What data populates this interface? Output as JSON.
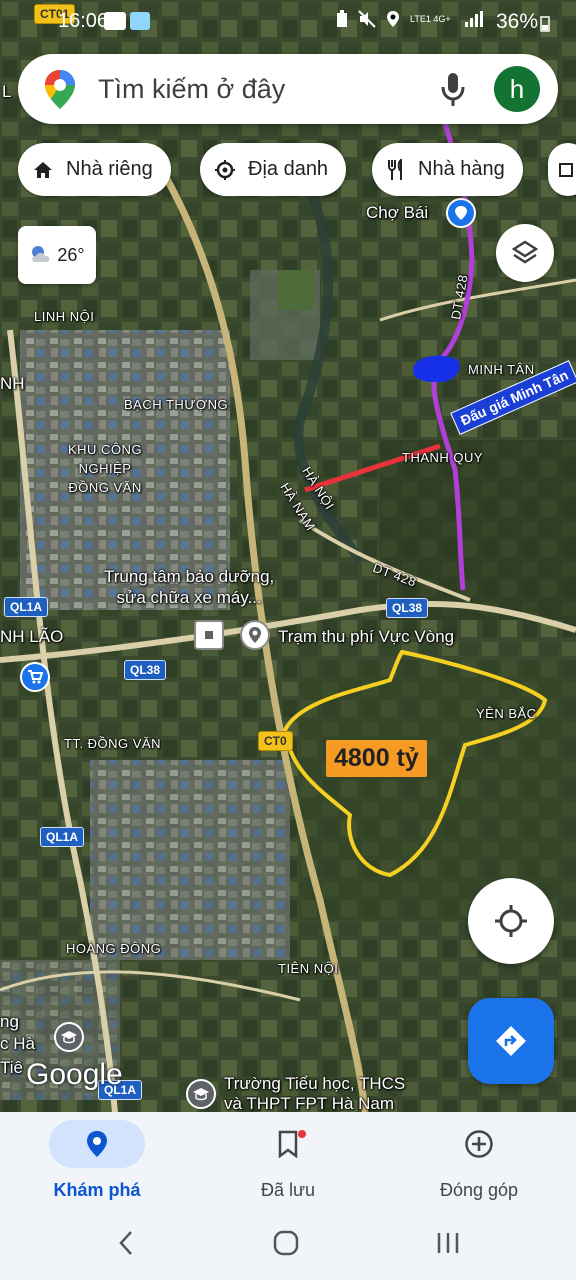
{
  "status_bar": {
    "time": "16:06",
    "network": "LTE1 4G+",
    "battery": "36%"
  },
  "search": {
    "placeholder": "Tìm kiếm ở đây",
    "avatar_letter": "h"
  },
  "chips": [
    {
      "label": "Nhà riêng",
      "icon": "home-icon"
    },
    {
      "label": "Địa danh",
      "icon": "landmark-icon"
    },
    {
      "label": "Nhà hàng",
      "icon": "restaurant-icon"
    }
  ],
  "weather": {
    "temp": "26°",
    "icon": "partly-cloudy-icon"
  },
  "map": {
    "places": {
      "cho_bai": "Chợ Bái",
      "linh_noi": "LINH NỘI",
      "bach_thuong": "BẠCH THƯỢNG",
      "kcn": "KHU CÔNG\nNGHIỆP\nĐỒNG VĂN",
      "minh_tan": "MINH TÂN",
      "thanh_quy": "THANH QUY",
      "ha_noi": "HÀ NỘI",
      "ha_nam": "HÀ NAM",
      "service_center": "Trung tâm bảo dưỡng,\nsửa chữa xe máy...",
      "toll": "Trạm thu phí Vực Vòng",
      "nh_lao": "NH LÃO",
      "yen_bac": "YÊN BẮC",
      "tt_dong_van": "TT. ĐỒNG VĂN",
      "hoang_dong": "HOÀNG ĐÔNG",
      "tien_noi": "TIÊN NỘI",
      "school": "Trường Tiểu học, THCS\nvà THPT FPT Hà Nam",
      "left_cut_1": "L",
      "left_cut_2": "NH",
      "left_cut_3": "ng",
      "left_cut_4": "c Hà",
      "left_cut_5": "Tiê"
    },
    "roads": {
      "dt428_top": "DT 428",
      "dt428_bottom": "DT 428",
      "ql38_a": "QL38",
      "ql38_b": "QL38",
      "ql1a_a": "QL1A",
      "ql1a_b": "QL1A",
      "ql1a_c": "QL1A",
      "ct01_top": "CT01",
      "ct01_mid": "CT0"
    },
    "annotations": {
      "price": "4800 tỷ",
      "auction": "Đấu giá Minh Tân"
    },
    "annotation_colors": {
      "price_bg": "#f59a23",
      "outline": "#f5d020",
      "route": "#b040d8",
      "red_line": "#e8323c",
      "blue_blob": "#1530e6"
    },
    "attribution": "Google"
  },
  "bottom_nav": [
    {
      "label": "Khám phá",
      "icon": "explore-pin-icon",
      "active": true
    },
    {
      "label": "Đã lưu",
      "icon": "bookmark-icon",
      "active": false
    },
    {
      "label": "Đóng góp",
      "icon": "add-circle-icon",
      "active": false
    }
  ]
}
